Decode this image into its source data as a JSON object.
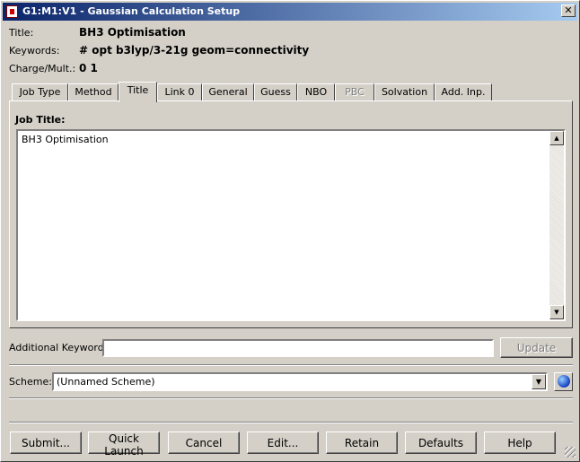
{
  "window": {
    "title": "G1:M1:V1 - Gaussian Calculation Setup",
    "close_symbol": "✕"
  },
  "info": [
    {
      "label": "Title:",
      "value": "BH3 Optimisation"
    },
    {
      "label": "Keywords:",
      "value": "# opt b3lyp/3-21g geom=connectivity"
    },
    {
      "label": "Charge/Mult.:",
      "value": "0 1"
    }
  ],
  "tabs": [
    {
      "label": "Job Type"
    },
    {
      "label": "Method"
    },
    {
      "label": "Title",
      "active": true
    },
    {
      "label": "Link 0"
    },
    {
      "label": "General"
    },
    {
      "label": "Guess"
    },
    {
      "label": "NBO"
    },
    {
      "label": "PBC",
      "disabled": true
    },
    {
      "label": "Solvation"
    },
    {
      "label": "Add. Inp."
    }
  ],
  "title_panel": {
    "label": "Job Title:",
    "text": "BH3 Optimisation"
  },
  "additional_keywords": {
    "label": "Additional Keywords:",
    "value": "",
    "update_label": "Update"
  },
  "scheme": {
    "label": "Scheme:",
    "value": "(Unnamed Scheme)"
  },
  "buttons": [
    "Submit...",
    "Quick Launch",
    "Cancel",
    "Edit...",
    "Retain",
    "Defaults",
    "Help"
  ]
}
